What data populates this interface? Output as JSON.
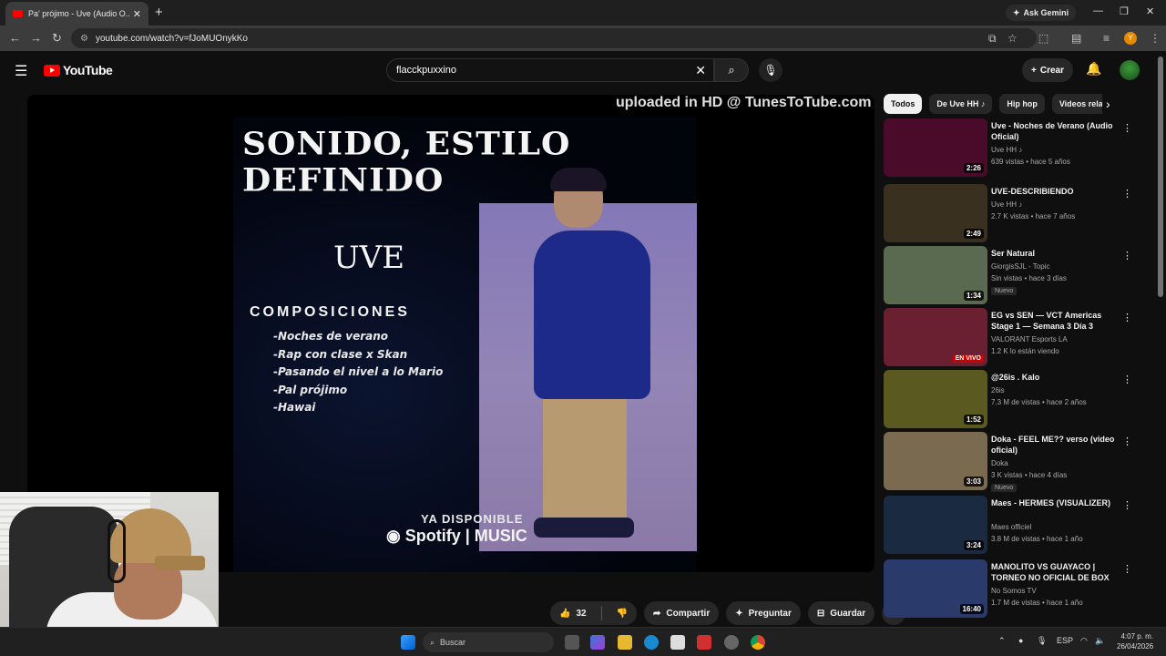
{
  "browser": {
    "tab_title": "Pa' prójimo - Uve (Audio O...",
    "ask_gemini": "Ask Gemini",
    "url": "youtube.com/watch?v=fJoMUOnykKo"
  },
  "youtube": {
    "logo_text": "YouTube",
    "search_value": "flacckpuxxino",
    "create_label": "Crear"
  },
  "video": {
    "watermark": "uploaded in HD @ TunesToTube.com",
    "art_title": "SONIDO, ESTILO DEFINIDO",
    "art_artist": "UVE",
    "art_compositions_heading": "COMPOSICIONES",
    "art_tracks": [
      "-Noches de verano",
      "-Rap con clase x Skan",
      "-Pasando el nivel a lo Mario",
      "-Pal prójimo",
      "-Hawai"
    ],
    "art_available": "YA DISPONIBLE",
    "art_platforms": "Spotify | MUSIC"
  },
  "actions": {
    "likes": "32",
    "share": "Compartir",
    "ask": "Preguntar",
    "save": "Guardar"
  },
  "chips": [
    "Todos",
    "De Uve HH ♪",
    "Hip hop",
    "Videos rela"
  ],
  "recommendations": [
    {
      "title": "Uve - Noches de Verano (Audio Oficial)",
      "channel": "Uve HH ♪",
      "meta": "639 vistas • hace 5 años",
      "duration": "2:26",
      "thumb_color": "#4a0a2a"
    },
    {
      "title": "UVE-DESCRIBIENDO",
      "channel": "Uve HH ♪",
      "meta": "2.7 K vistas • hace 7 años",
      "duration": "2:49",
      "thumb_color": "#3a3020"
    },
    {
      "title": "Ser Natural",
      "channel": "GiorgisSJL - Topic",
      "meta": "Sin vistas • hace 3 días",
      "duration": "1:34",
      "badge": "Nuevo",
      "thumb_color": "#5a6a50"
    },
    {
      "title": "EG vs SEN — VCT Americas Stage 1 — Semana 3 Día 3",
      "channel": "VALORANT Esports LA",
      "meta": "1.2 K lo están viendo",
      "live": "EN VIVO",
      "thumb_color": "#6a2030"
    },
    {
      "title": "@26is . Kalo",
      "channel": "26is",
      "meta": "7.3 M de vistas • hace 2 años",
      "duration": "1:52",
      "thumb_color": "#5a5a20"
    },
    {
      "title": "Doka - FEEL ME?? verso (video oficial)",
      "channel": "Doka",
      "meta": "3 K vistas • hace 4 días",
      "duration": "3:03",
      "badge": "Nuevo",
      "thumb_color": "#7a6a50"
    },
    {
      "title": "Maes - HERMES (VISUALIZER)",
      "channel": "Maes officiel",
      "meta": "3.8 M de vistas • hace 1 año",
      "duration": "3:24",
      "thumb_color": "#1a2a40"
    },
    {
      "title": "MANOLITO VS GUAYACO | TORNEO NO OFICIAL DE BOX -...",
      "channel": "No Somos TV",
      "meta": "1.7 M de vistas • hace 1 año",
      "duration": "16:40",
      "thumb_color": "#2a3a6a"
    }
  ],
  "taskbar": {
    "search": "Buscar",
    "lang": "ESP",
    "time": "4:07 p. m.",
    "date": "26/04/2026"
  }
}
